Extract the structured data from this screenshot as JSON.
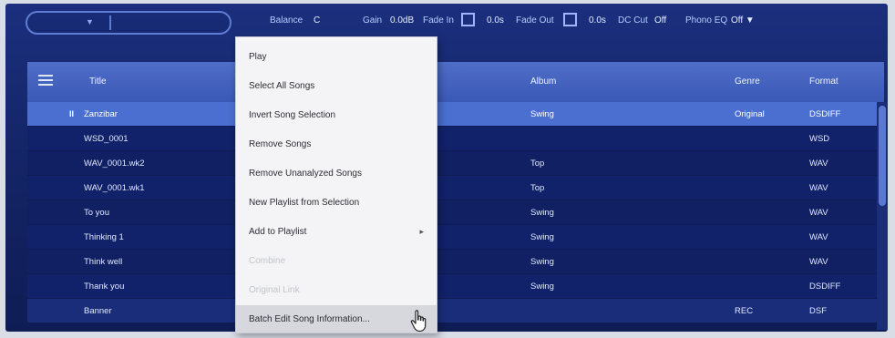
{
  "topbar": {
    "seek_knob": "▼",
    "balance_label": "Balance",
    "balance_value": "C",
    "gain_label": "Gain",
    "gain_value": "0.0dB",
    "fade_in_label": "Fade In",
    "fade_in_value": "0.0s",
    "fade_out_label": "Fade Out",
    "fade_out_value": "0.0s",
    "dc_cut_label": "DC Cut",
    "dc_cut_value": "Off",
    "phono_eq_label": "Phono EQ",
    "phono_eq_value": "Off ▼"
  },
  "table": {
    "headers": {
      "title": "Title",
      "album": "Album",
      "genre": "Genre",
      "format": "Format"
    },
    "playing_marker": "II",
    "rows": [
      {
        "title": "Zanzibar",
        "album": "Swing",
        "genre": "Original",
        "format": "DSDIFF"
      },
      {
        "title": "WSD_0001",
        "album": "",
        "genre": "",
        "format": "WSD"
      },
      {
        "title": "WAV_0001.wk2",
        "album": "Top",
        "genre": "",
        "format": "WAV"
      },
      {
        "title": "WAV_0001.wk1",
        "album": "Top",
        "genre": "",
        "format": "WAV"
      },
      {
        "title": "To you",
        "album": "Swing",
        "genre": "",
        "format": "WAV"
      },
      {
        "title": "Thinking 1",
        "album": "Swing",
        "genre": "",
        "format": "WAV"
      },
      {
        "title": "Think well",
        "album": "Swing",
        "genre": "",
        "format": "WAV"
      },
      {
        "title": "Thank you",
        "album": "Swing",
        "genre": "",
        "format": "DSDIFF"
      },
      {
        "title": "Banner",
        "album": "",
        "genre": "REC",
        "format": "DSF"
      }
    ]
  },
  "context_menu": {
    "items": [
      {
        "label": "Play",
        "enabled": true
      },
      {
        "label": "Select All Songs",
        "enabled": true
      },
      {
        "label": "Invert Song Selection",
        "enabled": true
      },
      {
        "label": "Remove Songs",
        "enabled": true
      },
      {
        "label": "Remove Unanalyzed Songs",
        "enabled": true
      },
      {
        "label": "New Playlist from Selection",
        "enabled": true
      },
      {
        "label": "Add to Playlist",
        "enabled": true,
        "submenu_arrow": "▸"
      },
      {
        "label": "Combine",
        "enabled": false
      },
      {
        "label": "Original Link",
        "enabled": false
      },
      {
        "label": "Batch Edit Song Information...",
        "enabled": true,
        "hover": true
      }
    ]
  },
  "colors": {
    "background": "#142567",
    "header": "#3a58b6",
    "selected_row": "#4a6fd0",
    "menu_bg": "#f4f4f7"
  }
}
